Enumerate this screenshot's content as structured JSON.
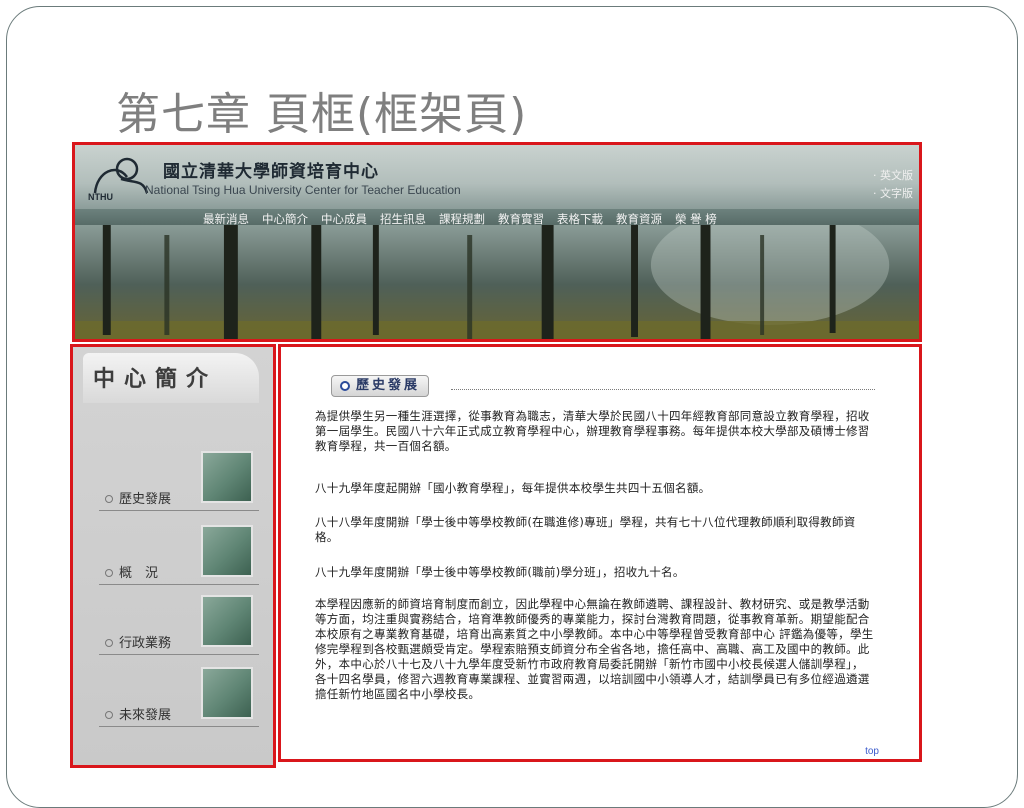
{
  "slide": {
    "title": "第七章 頁框(框架頁)"
  },
  "banner": {
    "logo_text": "NTHU",
    "org_cn": "國立清華大學師資培育中心",
    "org_en": "National Tsing Hua University Center for Teacher Education",
    "lang_links": [
      "· 英文版",
      "· 文字版"
    ],
    "nav": [
      "最新消息",
      "中心簡介",
      "中心成員",
      "招生訊息",
      "課程規劃",
      "教育實習",
      "表格下載",
      "教育資源",
      "榮 譽 榜"
    ]
  },
  "sidebar": {
    "title": "中心簡介",
    "items": [
      {
        "label": "歷史發展"
      },
      {
        "label": "概　況"
      },
      {
        "label": "行政業務"
      },
      {
        "label": "未來發展"
      }
    ]
  },
  "content": {
    "section_title": "歷史發展",
    "paragraphs": [
      "為提供學生另一種生涯選擇，從事教育為職志，清華大學於民國八十四年經教育部同意設立教育學程，招收第一屆學生。民國八十六年正式成立教育學程中心，辦理教育學程事務。每年提供本校大學部及碩博士修習教育學程，共一百個名額。",
      "八十九學年度起開辦「國小教育學程」，每年提供本校學生共四十五個名額。",
      "八十八學年度開辦「學士後中等學校教師(在職進修)專班」學程，共有七十八位代理教師順利取得教師資格。",
      "八十九學年度開辦「學士後中等學校教師(職前)學分班」，招收九十名。",
      "本學程因應新的師資培育制度而創立，因此學程中心無論在教師遴聘、課程設計、教材研究、或是教學活動等方面，均注重與實務結合，培育準教師優秀的專業能力，探討台灣教育問題，從事教育革新。期望能配合本校原有之專業教育基礎，培育出高素質之中小學教師。本中心中等學程曾受教育部中心 評鑑為優等，學生修完學程到各校甄選頗受肯定。學程索賠預支師資分布全省各地，擔任高中、高職、高工及國中的教師。此外，本中心於八十七及八十九學年度受新竹市政府教育局委託開辦「新竹市國中小校長候選人儲訓學程」，各十四名學員，修習六週教育專業課程、並實習兩週，以培訓國中小領導人才，結訓學員已有多位經過遴選擔任新竹地區國名中小學校長。"
    ],
    "top_link": "top"
  },
  "colors": {
    "highlight_border": "#d9161b",
    "nav_text": "#f3f3f3",
    "section_text": "#2a3a66"
  }
}
